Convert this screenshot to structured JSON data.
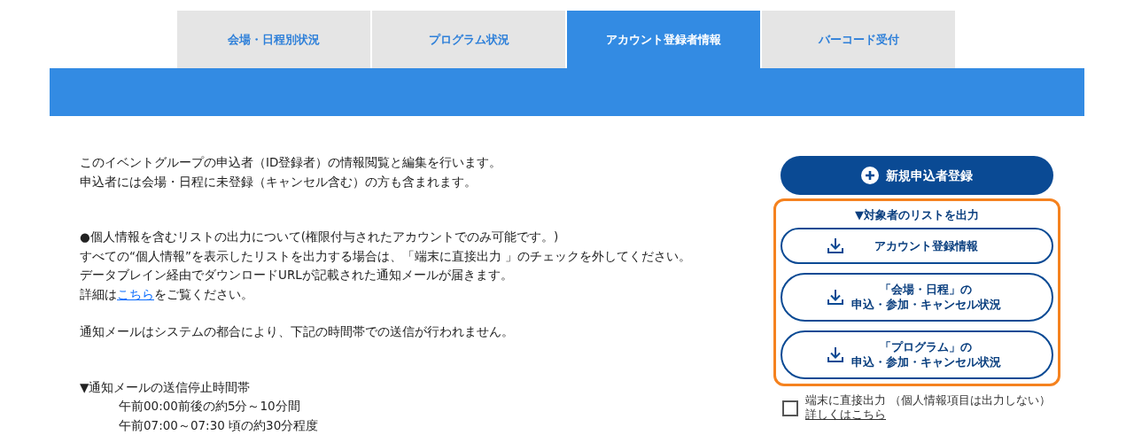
{
  "tabs": [
    {
      "label": "会場・日程別状況",
      "selected": false
    },
    {
      "label": "プログラム状況",
      "selected": false
    },
    {
      "label": "アカウント登録者情報",
      "selected": true
    },
    {
      "label": "バーコード受付",
      "selected": false
    }
  ],
  "intro": [
    "このイベントグループの申込者（ID登録者）の情報閲覧と編集を行います。",
    "申込者には会場・日程に未登録（キャンセル含む）の方も含まれます。"
  ],
  "notice": {
    "lines": [
      "●個人情報を含むリストの出力について(権限付与されたアカウントでのみ可能です。)",
      "すべての“個人情報”を表示したリストを出力する場合は、「端末に直接出力 」のチェックを外してください。",
      "データブレイン経由でダウンロードURLが記載された通知メールが届きます。"
    ],
    "detail": {
      "before": "詳細は",
      "link": "こちら",
      "after": "をご覧ください。"
    }
  },
  "mail_note": "通知メールはシステムの都合により、下記の時間帯での送信が行われません。",
  "stop_times": {
    "title": "▼通知メールの送信停止時間帯",
    "items": [
      "午前00:00前後の約5分～10分間",
      "午前07:00～07:30 頃の約30分程度"
    ]
  },
  "new_button": "新規申込者登録",
  "export": {
    "title": "▼対象者のリストを出力",
    "buttons": [
      [
        "アカウント登録情報"
      ],
      [
        "「会場・日程」の",
        "申込・参加・キャンセル状況"
      ],
      [
        "「プログラム」の",
        "申込・参加・キャンセル状況"
      ]
    ]
  },
  "direct_output": {
    "label": "端末に直接出力 （個人情報項目は出力しない）",
    "checked": false,
    "link": "詳しくはこちら"
  }
}
